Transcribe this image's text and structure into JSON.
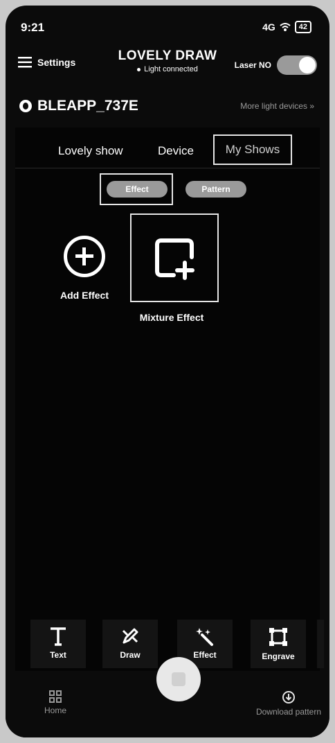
{
  "status_bar": {
    "time": "9:21",
    "signal": "4G",
    "battery": "42"
  },
  "header": {
    "menu_label": "Settings",
    "title": "LOVELY DRAW",
    "subtitle": "Light connected",
    "laser_label": "Laser NO",
    "laser_on": true
  },
  "device": {
    "name": "BLEAPP_737E",
    "more_label": "More light devices",
    "more_chevron": "»"
  },
  "tabs": [
    {
      "label": "Lovely show"
    },
    {
      "label": "Device"
    },
    {
      "label": "My Shows",
      "active": true
    }
  ],
  "chips": [
    {
      "label": "Effect",
      "active": true
    },
    {
      "label": "Pattern"
    }
  ],
  "cards": [
    {
      "label": "Add Effect",
      "icon": "add-circle-icon"
    },
    {
      "label": "Mixture Effect",
      "icon": "frame-plus-icon"
    }
  ],
  "tools": [
    {
      "label": "Text",
      "icon": "text-icon"
    },
    {
      "label": "Draw",
      "icon": "pencil-icon"
    },
    {
      "label": "Effect",
      "icon": "magic-wand-icon"
    },
    {
      "label": "Engrave",
      "icon": "engrave-frame-icon"
    }
  ],
  "bottom_nav": [
    {
      "label": "Home",
      "icon": "grid-icon"
    },
    {
      "label": "Download pattern",
      "icon": "download-icon"
    }
  ],
  "colors": {
    "background": "#0b0b0b",
    "chip": "#9a9a9a",
    "muted_text": "#9a9a9a"
  }
}
